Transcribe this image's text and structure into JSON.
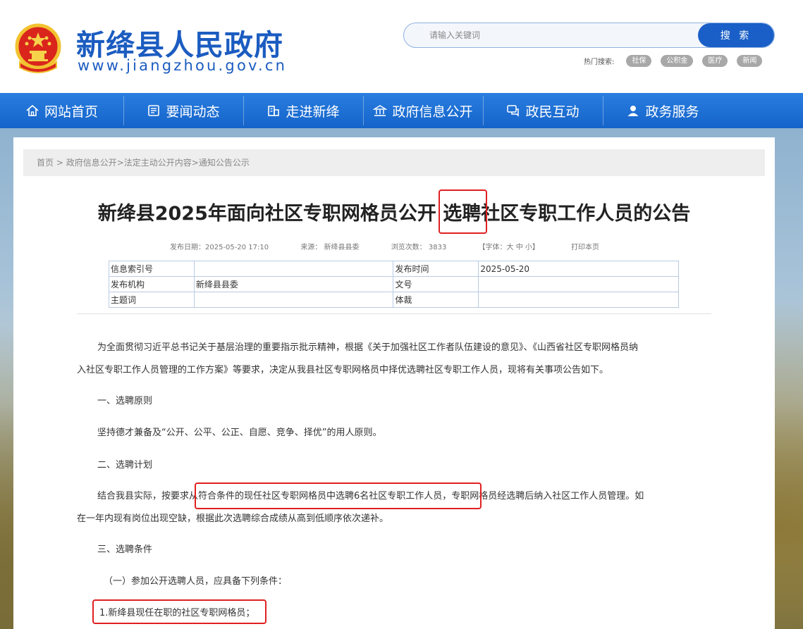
{
  "header": {
    "site_name": "新绛县人民政府",
    "site_url": "www.jiangzhou.gov.cn",
    "search": {
      "placeholder": "请输入关键词",
      "button_label": "搜 索"
    },
    "hot_search": {
      "label": "热门搜索:",
      "tags": [
        "社保",
        "公积金",
        "医疗",
        "新闻"
      ]
    }
  },
  "nav": [
    {
      "label": "网站首页",
      "icon": "home-icon"
    },
    {
      "label": "要闻动态",
      "icon": "news-icon"
    },
    {
      "label": "走进新绛",
      "icon": "building-icon"
    },
    {
      "label": "政府信息公开",
      "icon": "government-icon"
    },
    {
      "label": "政民互动",
      "icon": "chat-icon"
    },
    {
      "label": "政务服务",
      "icon": "user-icon"
    }
  ],
  "breadcrumb": {
    "home": "首页",
    "sep": " > ",
    "l1": "政府信息公开",
    "l2": ">法定主动公开内容",
    "l3": ">通知公告公示"
  },
  "article": {
    "title_before": "新绛县2025年面向社区专职网格员公开 ",
    "title_highlight": "选聘",
    "title_after": "社区专职工作人员的公告",
    "meta": {
      "date": "发布日期：2025-05-20 17:10",
      "source": "来源： 新绛县县委",
      "views": "浏览次数： 3833",
      "font_size": "【字体：大 中 小】",
      "print": "打印本页"
    },
    "info_table": [
      [
        "信息索引号",
        "",
        "发布时间",
        "2025-05-20"
      ],
      [
        "发布机构",
        "新绛县县委",
        "文号",
        ""
      ],
      [
        "主题词",
        "",
        "体裁",
        ""
      ]
    ],
    "paragraphs": {
      "intro_line1": "为全面贯彻习近平总书记关于基层治理的重要指示批示精神，根据《关于加强社区工作者队伍建设的意见》、《山西省社区专职网格员纳",
      "intro_line2": "入社区专职工作人员管理的工作方案》等要求，决定从我县社区专职网格员中择优选聘社区专职工作人员，现将有关事项公告如下。",
      "h1": "一、选聘原则",
      "p1": "坚持德才兼备及“公开、公平、公正、自愿、竞争、择优”的用人原则。",
      "h2": "二、选聘计划",
      "p2_a": "结合我县实际，按要求",
      "p2_hl": "从符合条件的现任社区专职网格员中选聘6名社区专职工作人员",
      "p2_b": "，专职网格员经选聘后纳入社区工作人员管理。如",
      "p2_line2": "在一年内现有岗位出现空缺，根据此次选聘综合成绩从高到低顺序依次递补。",
      "h3": "三、选聘条件",
      "sub1": "（一）参加公开选聘人员，应具备下列条件：",
      "item1": "1.新绛县现任在职的社区专职网格员；"
    }
  },
  "colors": {
    "brand_blue": "#1b5cc0",
    "nav_blue": "#1a6ad4",
    "highlight_red": "#e02020"
  }
}
